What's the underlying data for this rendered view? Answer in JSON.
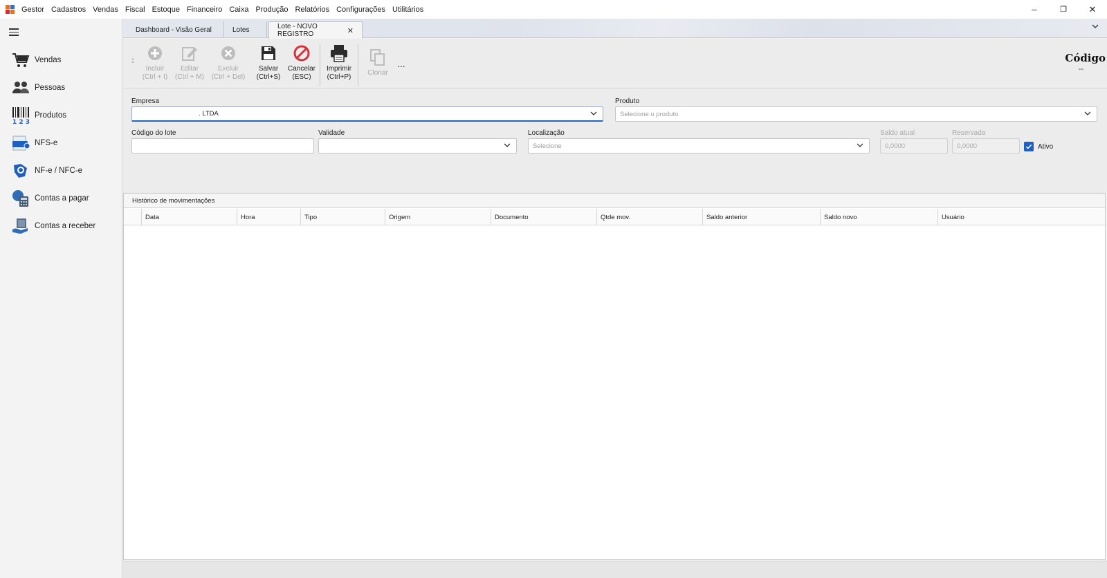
{
  "menu": {
    "items": [
      "Gestor",
      "Cadastros",
      "Vendas",
      "Fiscal",
      "Estoque",
      "Financeiro",
      "Caixa",
      "Produção",
      "Relatórios",
      "Configurações",
      "Utilitários"
    ]
  },
  "window": {
    "minimize": "–",
    "maximize": "❐",
    "close": "✕"
  },
  "sidebar": {
    "items": [
      {
        "label": "Vendas",
        "icon": "cart-icon"
      },
      {
        "label": "Pessoas",
        "icon": "people-icon"
      },
      {
        "label": "Produtos",
        "icon": "barcode-icon"
      },
      {
        "label": "NFS-e",
        "icon": "nfse-icon"
      },
      {
        "label": "NF-e / NFC-e",
        "icon": "nfe-icon"
      },
      {
        "label": "Contas a pagar",
        "icon": "calculator-icon"
      },
      {
        "label": "Contas a receber",
        "icon": "money-icon"
      }
    ]
  },
  "tabs": [
    {
      "label": "Dashboard - Visão Geral"
    },
    {
      "label": "Lotes"
    },
    {
      "label": "Lote - NOVO REGISTRO",
      "close": "✕"
    }
  ],
  "toolbar": {
    "incluir": {
      "line1": "Incluir",
      "line2": "(Ctrl + I)"
    },
    "editar": {
      "line1": "Editar",
      "line2": "(Ctrl + M)"
    },
    "excluir": {
      "line1": "Excluir",
      "line2": "(Ctrl + Del)"
    },
    "salvar": {
      "line1": "Salvar",
      "line2": "(Ctrl+S)"
    },
    "cancelar": {
      "line1": "Cancelar",
      "line2": "(ESC)"
    },
    "imprimir": {
      "line1": "Imprimir",
      "line2": "(Ctrl+P)"
    },
    "clonar": {
      "line1": "Clonar"
    },
    "more": "..."
  },
  "header": {
    "codigo_label": "Código",
    "codigo_value": "--"
  },
  "form": {
    "empresa_label": "Empresa",
    "empresa_value": ". LTDA",
    "produto_label": "Produto",
    "produto_placeholder": "Selecione o produto",
    "codigo_lote_label": "Código do lote",
    "codigo_lote_value": "",
    "validade_label": "Validade",
    "validade_value": "",
    "localizacao_label": "Localização",
    "localizacao_placeholder": "Selecione",
    "saldo_atual_label": "Saldo atual",
    "saldo_atual_value": "0,0000",
    "reservada_label": "Reservada",
    "reservada_value": "0,0000",
    "ativo_label": "Ativo",
    "ativo_checked": true
  },
  "grid": {
    "caption": "Histórico de movimentações",
    "columns": [
      "Data",
      "Hora",
      "Tipo",
      "Origem",
      "Documento",
      "Qtde mov.",
      "Saldo anterior",
      "Saldo novo",
      "Usuário"
    ]
  },
  "colors": {
    "accent": "#1f5fbf",
    "cancel_red": "#d8303a",
    "disabled_gray": "#a8a8a8"
  }
}
